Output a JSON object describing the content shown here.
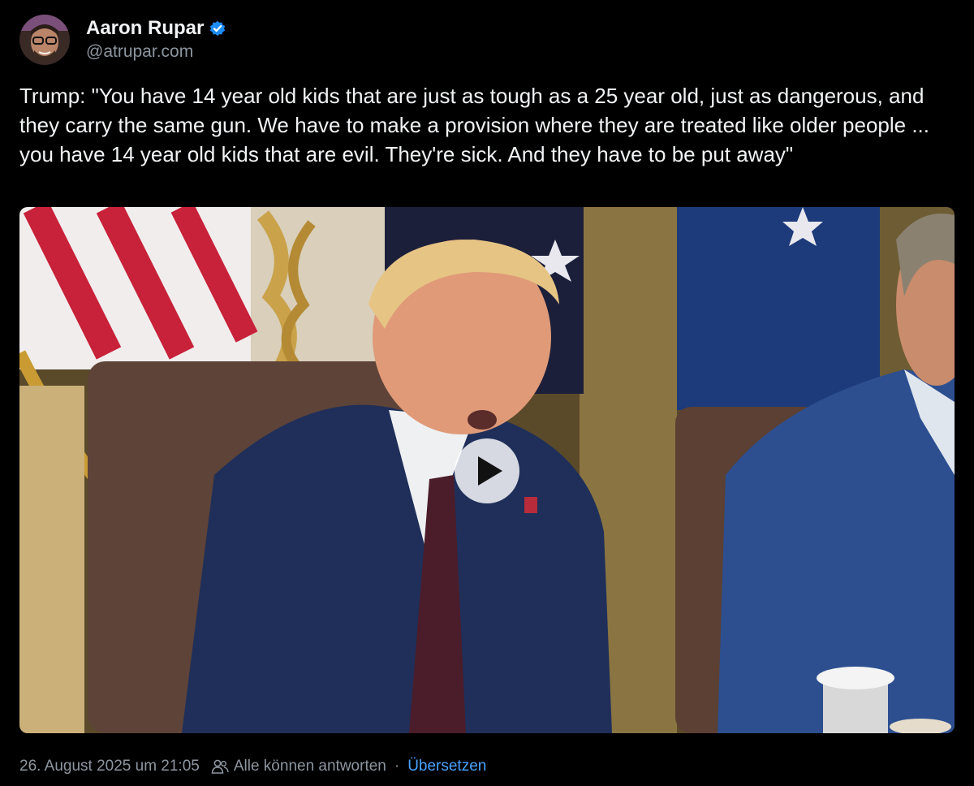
{
  "author": {
    "display_name": "Aaron Rupar",
    "handle": "@atrupar.com",
    "avatar_icon": "avatar-photo",
    "verified_icon": "verified-badge-icon",
    "verified_color": "#1d8cf8"
  },
  "post": {
    "text": "Trump: \"You have 14 year old kids that are just as tough as a 25 year old, just as dangerous, and they carry the same gun. We have to make a provision where they are treated like older people ... you have 14 year old kids that are evil. They're sick. And they have to be put away\""
  },
  "video": {
    "play_icon": "play-icon"
  },
  "footer": {
    "timestamp": "26. August 2025 um 21:05",
    "reply_icon": "people-icon",
    "reply_setting": "Alle können antworten",
    "separator": "·",
    "translate_label": "Übersetzen",
    "link_color": "#4aa3ff"
  }
}
